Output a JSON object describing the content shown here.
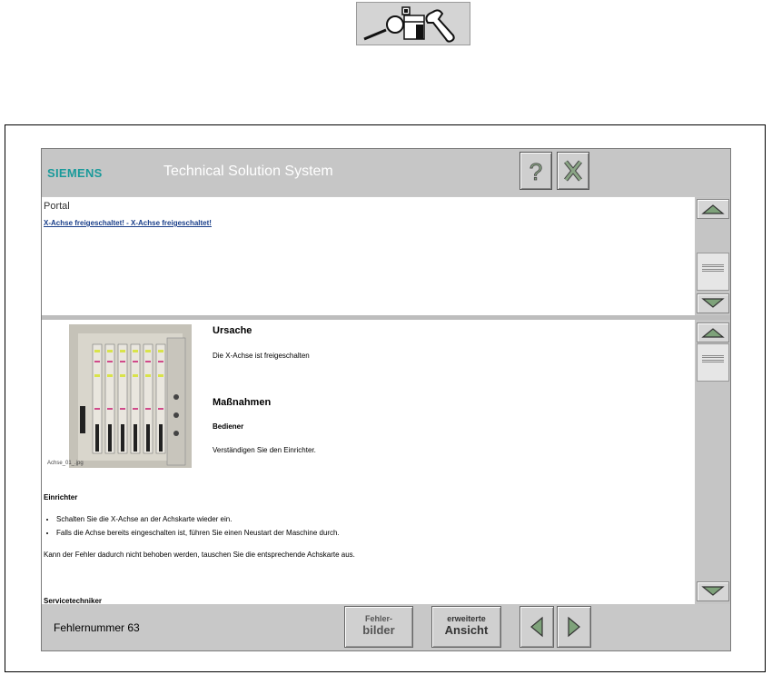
{
  "header": {
    "logo": "SIEMENS",
    "title": "Technical Solution System",
    "help_icon": "question-mark-icon",
    "close_icon": "close-x-icon"
  },
  "toolbar_top": {
    "icon": "diagnostics-tools-icon"
  },
  "portal": {
    "label": "Portal",
    "link_text": "X-Achse freigeschaltet! - X-Achse freigeschaltet!"
  },
  "content": {
    "image_caption": "Achse_01_.jpg",
    "ursache_heading": "Ursache",
    "ursache_text": "Die X-Achse ist freigeschalten",
    "massnahmen_heading": "Maßnahmen",
    "bediener_heading": "Bediener",
    "bediener_text": "Verständigen Sie den Einrichter.",
    "einrichter_heading": "Einrichter",
    "einrichter_items": [
      "Schalten Sie die X-Achse an der Achskarte wieder ein.",
      "Falls die Achse bereits eingeschalten ist, führen Sie einen Neustart der Maschine durch."
    ],
    "closing_text": "Kann der Fehler dadurch nicht behoben werden, tauschen Sie die entsprechende Achskarte aus.",
    "servicetechniker_heading": "Servicetechniker"
  },
  "footer": {
    "fehlernummer": "Fehlernummer 63",
    "btn_fehlerbilder_line1": "Fehler-",
    "btn_fehlerbilder_line2": "bilder",
    "btn_erweitert_line1": "erweiterte",
    "btn_erweitert_line2": "Ansicht",
    "prev_icon": "triangle-left-icon",
    "next_icon": "triangle-right-icon"
  },
  "colors": {
    "brand": "#199a9a",
    "link": "#1a3f8a",
    "arrow": "#7ea27a"
  }
}
